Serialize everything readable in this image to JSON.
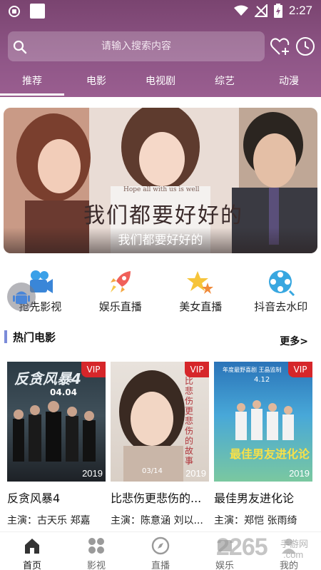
{
  "status_bar": {
    "time": "2:27"
  },
  "search": {
    "placeholder": "请输入搜索内容"
  },
  "tabs": [
    {
      "label": "推荐",
      "active": true
    },
    {
      "label": "电影"
    },
    {
      "label": "电视剧"
    },
    {
      "label": "综艺"
    },
    {
      "label": "动漫"
    }
  ],
  "banner": {
    "title_main": "我们都要好好的",
    "title_en": "Hope all with us is well",
    "caption": "我们都要好好的"
  },
  "shortcuts": [
    {
      "label": "抢先影视",
      "icon": "camera-icon"
    },
    {
      "label": "娱乐直播",
      "icon": "rocket-icon"
    },
    {
      "label": "美女直播",
      "icon": "stars-icon"
    },
    {
      "label": "抖音去水印",
      "icon": "film-reel-icon"
    }
  ],
  "section": {
    "title": "热门电影",
    "more": "更多>"
  },
  "movies": [
    {
      "title": "反贪风暴4",
      "cast": "主演：古天乐 郑嘉",
      "year": "2019",
      "badge": "VIP",
      "poster_title": "反贪风暴4",
      "poster_date": "04.04"
    },
    {
      "title": "比悲伤更悲伤的...",
      "cast": "主演：陈意涵 刘以...",
      "year": "2019",
      "badge": "VIP",
      "poster_title": "比悲伤更悲伤的故事",
      "poster_date": "03/14"
    },
    {
      "title": "最佳男友进化论",
      "cast": "主演：郑恺 张雨绮",
      "year": "2019",
      "badge": "VIP",
      "poster_title": "最佳男友进化论",
      "poster_date": "4.12",
      "poster_top": "年度最野喜剧 王晶监制"
    }
  ],
  "bottom_nav": [
    {
      "label": "首页",
      "active": true
    },
    {
      "label": "影视"
    },
    {
      "label": "直播"
    },
    {
      "label": "娱乐"
    },
    {
      "label": "我的"
    }
  ],
  "watermark": {
    "text": "2265",
    "sub": "手游网",
    "domain": ".com"
  },
  "colors": {
    "header": "#8f5687",
    "vip": "#d6262a",
    "section_bar": "#7b8bd9"
  }
}
